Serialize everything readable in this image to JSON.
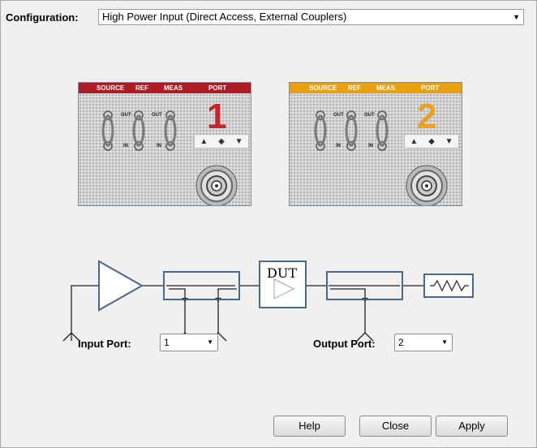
{
  "config": {
    "label": "Configuration:",
    "value": "High Power Input (Direct Access, External Couplers)"
  },
  "panel1": {
    "header": [
      "SOURCE",
      "REF",
      "MEAS",
      "PORT"
    ],
    "port_number": "1",
    "out": "OUT",
    "in": "IN",
    "color": "#b01c26",
    "num_color": "#c1272d"
  },
  "panel2": {
    "header": [
      "SOURCE",
      "REF",
      "MEAS",
      "PORT"
    ],
    "port_number": "2",
    "out": "OUT",
    "in": "IN",
    "color": "#e8a10e",
    "num_color": "#e8a128"
  },
  "diagram": {
    "dut_label": "DUT"
  },
  "input_port": {
    "label": "Input Port:",
    "value": "1"
  },
  "output_port": {
    "label": "Output Port:",
    "value": "2"
  },
  "buttons": {
    "help": "Help",
    "close": "Close",
    "apply": "Apply"
  },
  "icons": {
    "dropdown": "chevron-down-icon",
    "nav": [
      "up-triangle-icon",
      "diamond-icon",
      "down-triangle-icon"
    ]
  }
}
